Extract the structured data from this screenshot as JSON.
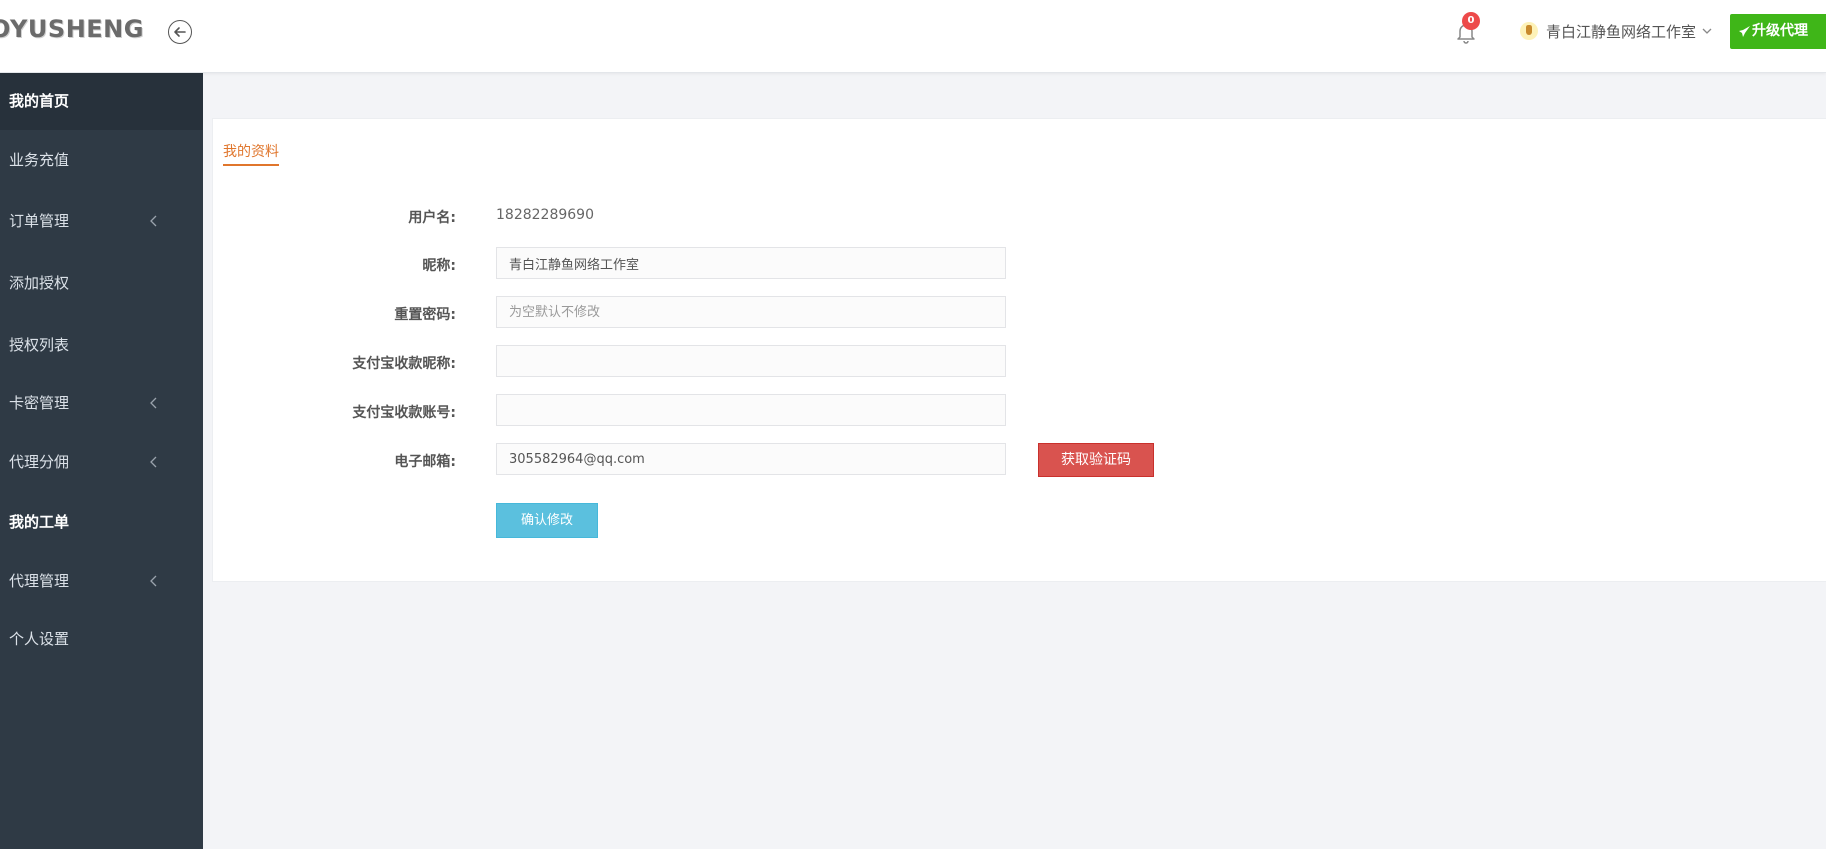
{
  "header": {
    "logo_text": "OYUSHENG",
    "notification_count": "0",
    "user_name": "青白江静鱼网络工作室",
    "upgrade_label": "升级代理"
  },
  "sidebar": {
    "items": [
      {
        "label": "我的首页"
      },
      {
        "label": "业务充值"
      },
      {
        "label": "订单管理"
      },
      {
        "label": "添加授权"
      },
      {
        "label": "授权列表"
      },
      {
        "label": "卡密管理"
      },
      {
        "label": "代理分佣"
      },
      {
        "label": "我的工单"
      },
      {
        "label": "代理管理"
      },
      {
        "label": "个人设置"
      }
    ]
  },
  "profile": {
    "tab_title": "我的资料",
    "username_label": "用户名:",
    "username_value": "18282289690",
    "nickname_label": "昵称:",
    "nickname_value": "青白江静鱼网络工作室",
    "password_label": "重置密码:",
    "password_placeholder": "为空默认不修改",
    "alipay_name_label": "支付宝收款昵称:",
    "alipay_name_value": "",
    "alipay_account_label": "支付宝收款账号:",
    "alipay_account_value": "",
    "email_label": "电子邮箱:",
    "email_value": "305582964@qq.com",
    "get_code_label": "获取验证码",
    "confirm_label": "确认修改"
  },
  "colors": {
    "sidebar_bg": "#2f3a45",
    "accent_orange": "#e0762c",
    "upgrade_green": "#3fb618",
    "danger_red": "#d9534f",
    "info_blue": "#5bc0de"
  }
}
